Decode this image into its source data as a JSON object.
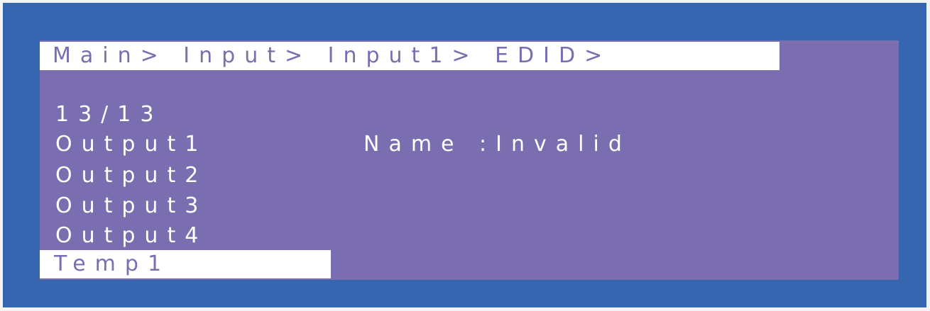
{
  "menu": {
    "breadcrumb": "Main> Input> Input1> EDID>",
    "counter": "13/13",
    "items": [
      "Output1",
      "Output2",
      "Output3",
      "Output4"
    ],
    "selected_item": "Temp1"
  },
  "info": {
    "label": "Name",
    "separator": " :",
    "value": "Invalid"
  },
  "colors": {
    "outer_bezel": "#3766b0",
    "screen_background": "#7a6db0",
    "highlight_background": "#ffffff",
    "text": "#ffffff"
  }
}
